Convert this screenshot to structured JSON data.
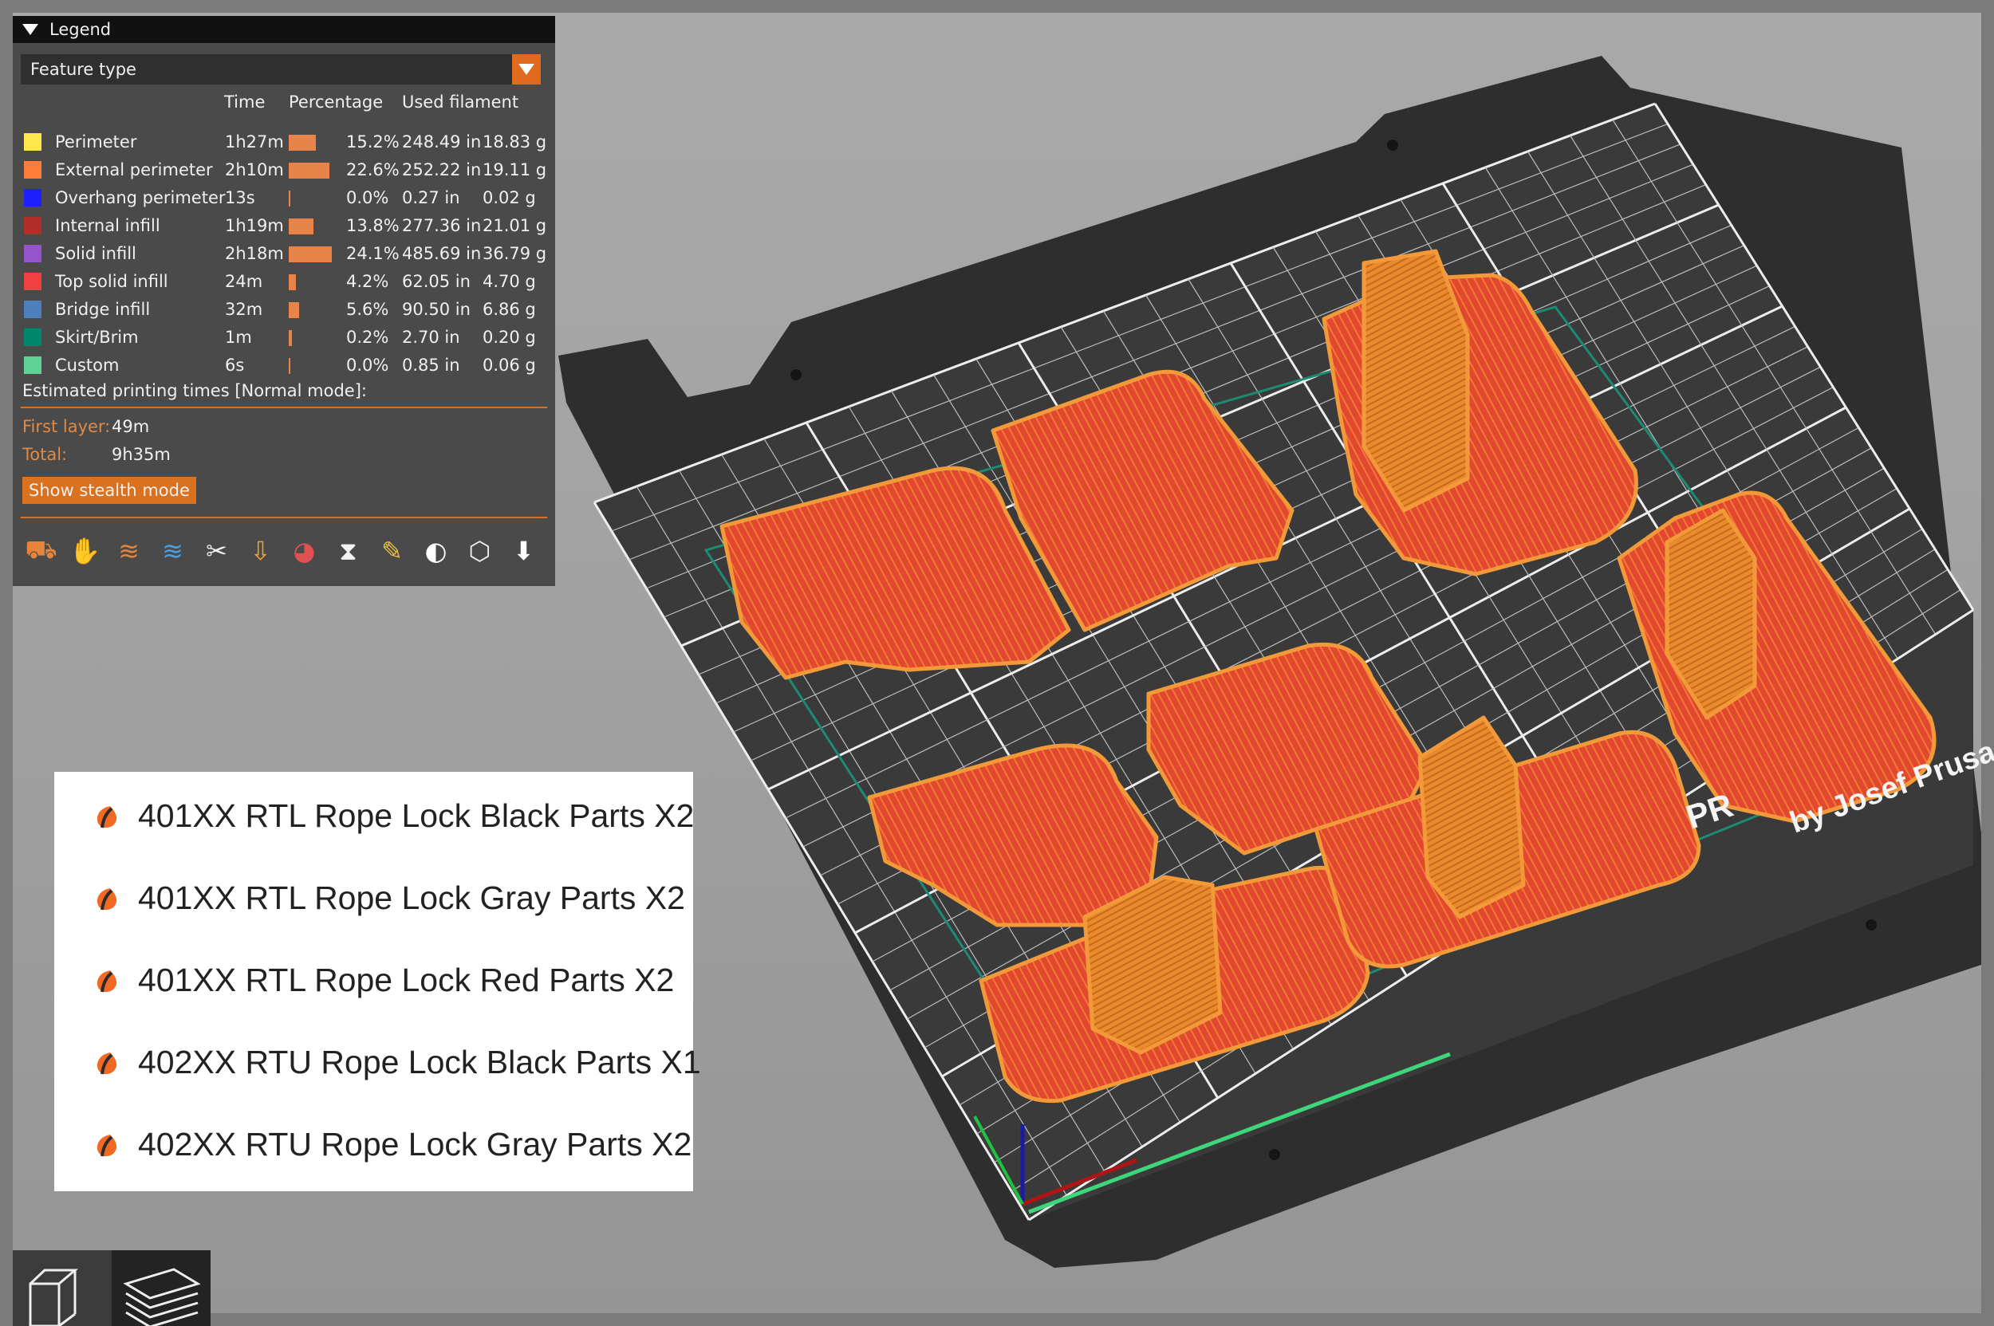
{
  "legend": {
    "title": "Legend",
    "view_type": "Feature type",
    "columns": {
      "time": "Time",
      "percentage": "Percentage",
      "used_filament": "Used filament"
    },
    "features": [
      {
        "name": "Perimeter",
        "color": "#ffe64d",
        "time": "1h27m",
        "percent": "15.2%",
        "length": "248.49 in",
        "weight": "18.83 g",
        "share": 0.152
      },
      {
        "name": "External perimeter",
        "color": "#ff7d38",
        "time": "2h10m",
        "percent": "22.6%",
        "length": "252.22 in",
        "weight": "19.11 g",
        "share": 0.226
      },
      {
        "name": "Overhang perimeter",
        "color": "#1f1fff",
        "time": "13s",
        "percent": "0.0%",
        "length": "0.27 in",
        "weight": "0.02 g",
        "share": 0.0
      },
      {
        "name": "Internal infill",
        "color": "#b03029",
        "time": "1h19m",
        "percent": "13.8%",
        "length": "277.36 in",
        "weight": "21.01 g",
        "share": 0.138
      },
      {
        "name": "Solid infill",
        "color": "#9654cc",
        "time": "2h18m",
        "percent": "24.1%",
        "length": "485.69 in",
        "weight": "36.79 g",
        "share": 0.241
      },
      {
        "name": "Top solid infill",
        "color": "#f04040",
        "time": "24m",
        "percent": "4.2%",
        "length": "62.05 in",
        "weight": "4.70 g",
        "share": 0.042
      },
      {
        "name": "Bridge infill",
        "color": "#4d80ba",
        "time": "32m",
        "percent": "5.6%",
        "length": "90.50 in",
        "weight": "6.86 g",
        "share": 0.056
      },
      {
        "name": "Skirt/Brim",
        "color": "#00876e",
        "time": "1m",
        "percent": "0.2%",
        "length": "2.70 in",
        "weight": "0.20 g",
        "share": 0.002
      },
      {
        "name": "Custom",
        "color": "#5ed194",
        "time": "6s",
        "percent": "0.0%",
        "length": "0.85 in",
        "weight": "0.06 g",
        "share": 0.0
      }
    ],
    "estimated_label": "Estimated printing times [Normal mode]:",
    "first_layer_label": "First layer:",
    "first_layer_value": "49m",
    "total_label": "Total:",
    "total_value": "9h35m",
    "stealth_button": "Show stealth mode",
    "toolbar_icons": [
      "travel-icon",
      "wipe-icon",
      "retractions-icon",
      "deretractions-icon",
      "seams-icon",
      "tool-changes-icon",
      "color-changes-icon",
      "pause-prints-icon",
      "custom-gcodes-icon",
      "center-of-gravity-icon",
      "shells-icon",
      "tool-marker-icon"
    ]
  },
  "project_list": [
    {
      "label": "401XX RTL Rope Lock Black Parts X2"
    },
    {
      "label": "401XX RTL Rope Lock Gray Parts X2"
    },
    {
      "label": "401XX RTL Rope Lock Red Parts X2"
    },
    {
      "label": "402XX RTU Rope Lock Black Parts X1"
    },
    {
      "label": "402XX RTU Rope Lock Gray Parts X2"
    }
  ],
  "bed": {
    "text_left": "PR",
    "text_right": "by Josef Prusa"
  },
  "colors": {
    "accent": "#e06b1e",
    "part": "#e0402e",
    "part_edge": "#f08a2a",
    "bed": "#2f2f2f",
    "grid": "#e8e8e8"
  }
}
